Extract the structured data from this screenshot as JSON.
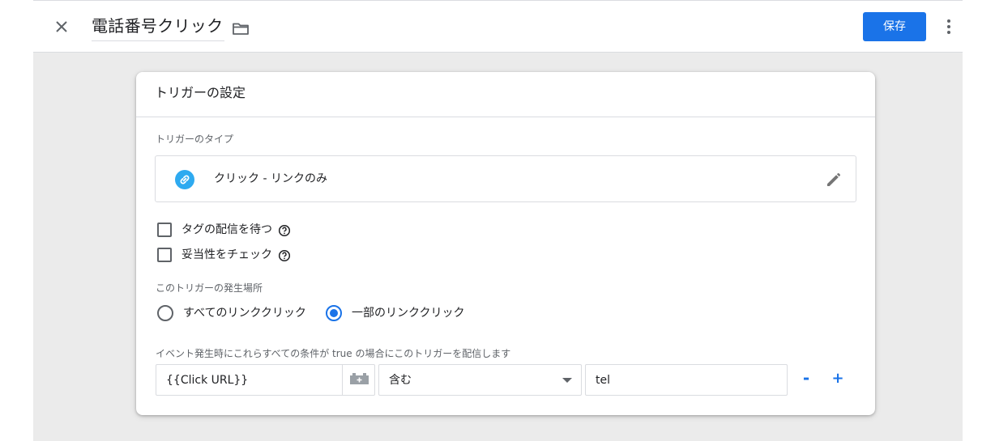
{
  "header": {
    "title": "電話番号クリック",
    "save_label": "保存",
    "close_icon": "close-icon",
    "folder_icon": "folder-icon",
    "more_icon": "more-vert-icon"
  },
  "card": {
    "title": "トリガーの設定",
    "trigger_type": {
      "label": "トリガーのタイプ",
      "name": "クリック - リンクのみ",
      "icon": "link-icon",
      "edit_icon": "pencil-icon"
    },
    "checkboxes": [
      {
        "label": "タグの配信を待つ",
        "checked": false
      },
      {
        "label": "妥当性をチェック",
        "checked": false
      }
    ],
    "fire_on": {
      "label": "このトリガーの発生場所",
      "options": [
        {
          "label": "すべてのリンククリック",
          "selected": false
        },
        {
          "label": "一部のリンククリック",
          "selected": true
        }
      ]
    },
    "condition": {
      "label": "イベント発生時にこれらすべての条件が true の場合にこのトリガーを配信します",
      "variable": "{{Click URL}}",
      "operator": "含む",
      "value": "tel",
      "remove_label": "-",
      "add_label": "+"
    }
  },
  "colors": {
    "accent": "#1a73e8",
    "link_icon_bg": "#2eaaf0",
    "canvas_bg": "#ebebeb"
  }
}
